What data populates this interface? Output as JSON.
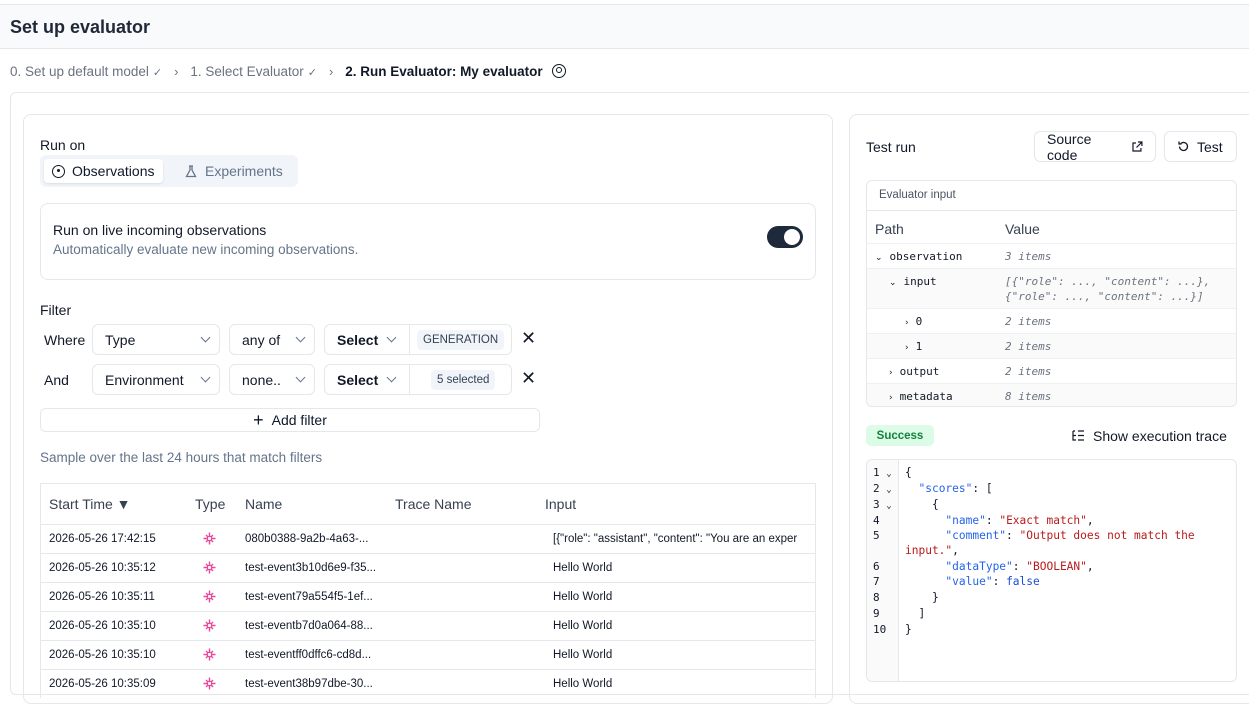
{
  "header": {
    "title": "Set up evaluator"
  },
  "breadcrumb": {
    "step0": "0. Set up default model",
    "step1": "1. Select Evaluator",
    "step2": "2. Run Evaluator: My evaluator",
    "check": "✓",
    "sep": "›"
  },
  "run_on": {
    "label": "Run on",
    "tabs": {
      "observations": "Observations",
      "experiments": "Experiments"
    },
    "live": {
      "title": "Run on live incoming observations",
      "desc": "Automatically evaluate new incoming observations.",
      "enabled": true
    }
  },
  "filter": {
    "label": "Filter",
    "rows": [
      {
        "conj": "Where",
        "column": "Type",
        "op": "any of",
        "select": "Select",
        "value": "GENERATION"
      },
      {
        "conj": "And",
        "column": "Environment",
        "op": "none..",
        "select": "Select",
        "value": "5 selected"
      }
    ],
    "remove": "✕",
    "add_label": "Add filter",
    "add_plus": "+"
  },
  "sample_text": "Sample over the last 24 hours that match filters",
  "table": {
    "headers": {
      "start": "Start Time ▼",
      "type": "Type",
      "name": "Name",
      "trace": "Trace Name",
      "input": "Input"
    },
    "rows": [
      {
        "time": "2026-05-26 17:42:15",
        "name": "080b0388-9a2b-4a63-...",
        "trace": "",
        "input": "[{\"role\": \"assistant\", \"content\": \"You are an exper"
      },
      {
        "time": "2026-05-26 10:35:12",
        "name": "test-event3b10d6e9-f35...",
        "trace": "",
        "input": "Hello World"
      },
      {
        "time": "2026-05-26 10:35:11",
        "name": "test-event79a554f5-1ef...",
        "trace": "",
        "input": "Hello World"
      },
      {
        "time": "2026-05-26 10:35:10",
        "name": "test-eventb7d0a064-88...",
        "trace": "",
        "input": "Hello World"
      },
      {
        "time": "2026-05-26 10:35:10",
        "name": "test-eventff0dffc6-cd8d...",
        "trace": "",
        "input": "Hello World"
      },
      {
        "time": "2026-05-26 10:35:09",
        "name": "test-event38b97dbe-30...",
        "trace": "",
        "input": "Hello World"
      }
    ]
  },
  "test_run": {
    "title": "Test run",
    "source_btn": "Source code",
    "test_btn": "Test",
    "input_title": "Evaluator input",
    "col_path": "Path",
    "col_value": "Value",
    "tree": [
      {
        "key": "observation",
        "value": "3 items",
        "chev": "⌄"
      },
      {
        "key": "input",
        "value": "[{\"role\": ..., \"content\": ...},",
        "value2": "{\"role\": ..., \"content\": ...}]",
        "chev": "⌄"
      },
      {
        "key": "0",
        "value": "2 items",
        "chev": "›"
      },
      {
        "key": "1",
        "value": "2 items",
        "chev": "›"
      },
      {
        "key": "output",
        "value": "2 items",
        "chev": "›"
      },
      {
        "key": "metadata",
        "value": "8 items",
        "chev": "›"
      }
    ],
    "status": "Success",
    "trace_btn": "Show execution trace",
    "code_lines": [
      {
        "n": "1",
        "fold": "⌄"
      },
      {
        "n": "2",
        "fold": "⌄"
      },
      {
        "n": "3",
        "fold": "⌄"
      },
      {
        "n": "4",
        "fold": ""
      },
      {
        "n": "5",
        "fold": ""
      },
      {
        "n": "6",
        "fold": ""
      },
      {
        "n": "7",
        "fold": ""
      },
      {
        "n": "8",
        "fold": ""
      },
      {
        "n": "9",
        "fold": ""
      },
      {
        "n": "10",
        "fold": ""
      }
    ],
    "json": {
      "open": "{",
      "scores_key": "\"scores\"",
      "arr_open": ": [",
      "obj_open": "{",
      "name_key": "\"name\"",
      "name_val": "\"Exact match\"",
      "comment_key": "\"comment\"",
      "comment_val": "\"Output does not match the",
      "comment_val2": "input.\"",
      "dt_key": "\"dataType\"",
      "dt_val": "\"BOOLEAN\"",
      "value_key": "\"value\"",
      "value_val": "false",
      "obj_close": "}",
      "arr_close": "]",
      "close": "}"
    }
  }
}
